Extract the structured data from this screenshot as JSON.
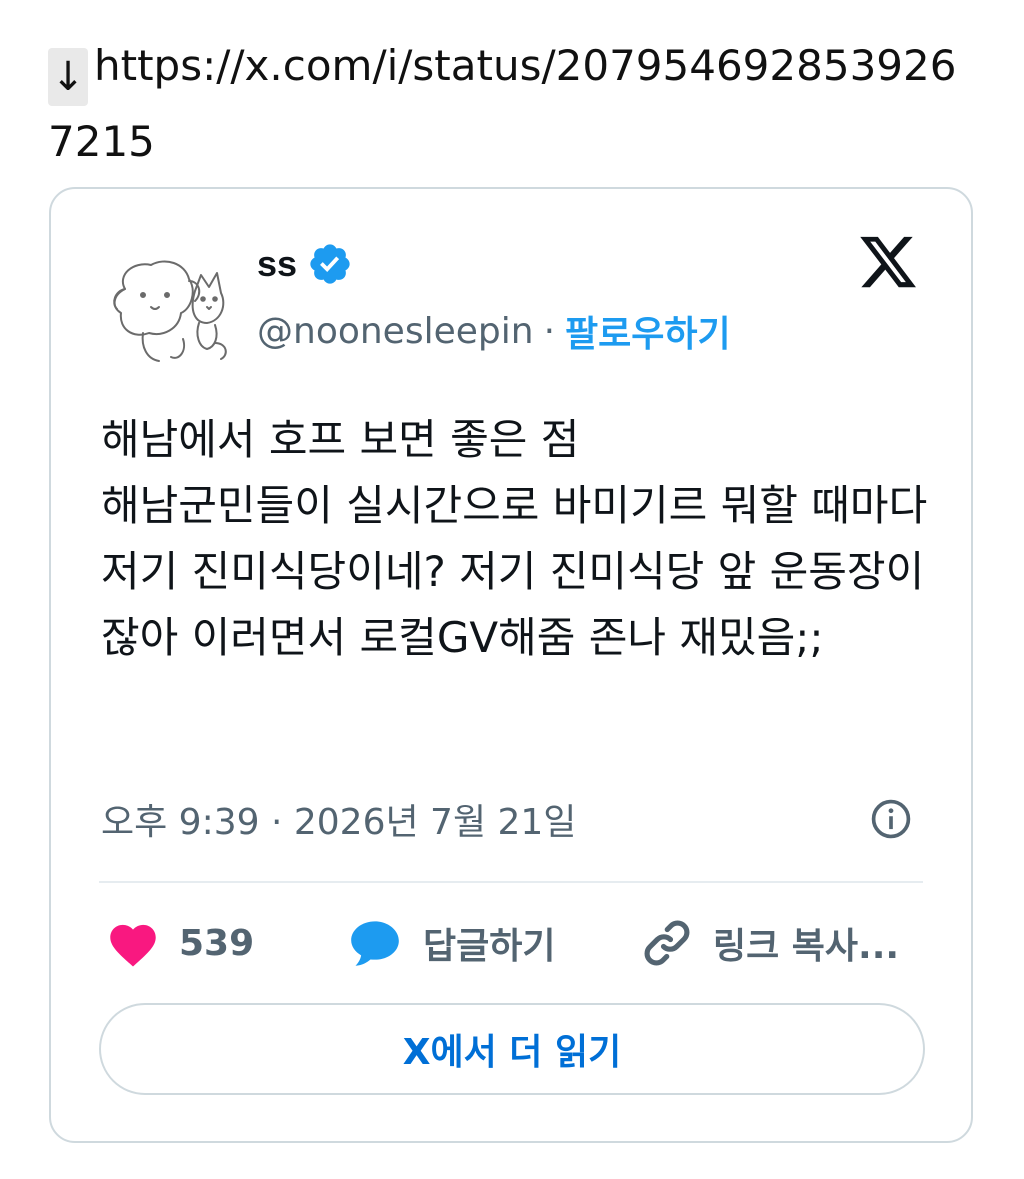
{
  "link": {
    "arrow": "↓",
    "url": "https://x.com/i/status/2079546928539267215"
  },
  "tweet": {
    "display_name": "ss",
    "handle": "@noonesleepin",
    "separator": "·",
    "follow_label": "팔로우하기",
    "text": "해남에서 호프 보면 좋은 점\n해남군민들이 실시간으로 바미기르 뭐할 때마다 저기 진미식당이네? 저기 진미식당 앞 운동장이잖아 이러면서 로컬GV해줌 존나 재밌음;;",
    "timestamp": "오후 9:39 · 2026년 7월 21일",
    "likes": "539",
    "reply_label": "답글하기",
    "copy_link_label": "링크 복사...",
    "read_more_label": "X에서 더 읽기"
  },
  "icons": {
    "download": "down-arrow-icon",
    "verified": "verified-badge-icon",
    "logo": "x-logo-icon",
    "info": "info-icon",
    "like": "heart-icon",
    "reply": "speech-bubble-icon",
    "copy": "link-icon"
  },
  "colors": {
    "accent": "#1d9bf0",
    "like": "#f91880",
    "secondary_text": "#536471",
    "read_more_text": "#006fd6",
    "border": "#cfd9de"
  }
}
